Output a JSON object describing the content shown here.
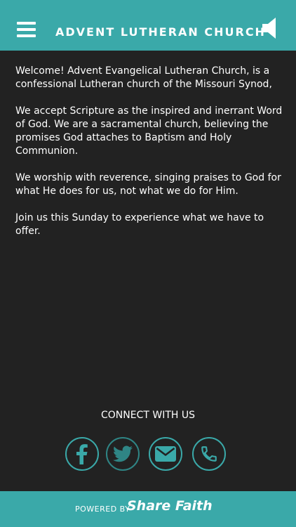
{
  "header": {
    "title": "ADVENT LUTHERAN CHURCH",
    "menu_icon": "hamburger-menu-icon",
    "speaker_icon": "speaker-icon"
  },
  "content": {
    "paragraphs": [
      "Welcome! Advent Evangelical Lutheran Church, is a confessional Lutheran church of the Missouri Synod,",
      "We accept Scripture as the inspired and inerrant Word of God. We are a sacramental church, believing the promises God attaches to Baptism and Holy Communion.",
      "We worship with reverence, singing praises to God for what He does for us, not what we do for Him.",
      "Join us this Sunday to experience what we have to offer."
    ]
  },
  "connect": {
    "title": "CONNECT WITH US",
    "icons": [
      "facebook-icon",
      "twitter-icon",
      "email-icon",
      "phone-icon"
    ]
  },
  "footer": {
    "powered_label": "POWERED BY",
    "brand": "Share Faith"
  },
  "colors": {
    "accent": "#3aa9a9",
    "background": "#222222",
    "text": "#ffffff"
  }
}
